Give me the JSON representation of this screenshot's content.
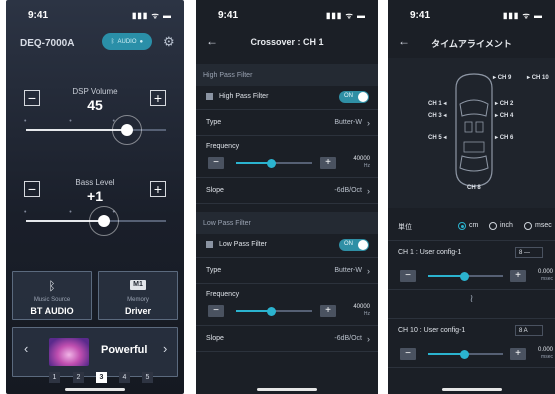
{
  "s1": {
    "time": "9:41",
    "signal": "▮▮▮ ᯤ ▬",
    "model": "DEQ-7000A",
    "source_pill": "AUDIO",
    "dsp": {
      "label": "DSP Volume",
      "value": "45",
      "level": 0.72
    },
    "bass": {
      "label": "Bass Level",
      "value": "+1",
      "level": 0.56
    },
    "minus": "−",
    "plus": "+",
    "music_source": {
      "caption": "Music Source",
      "value": "BT AUDIO"
    },
    "memory": {
      "badge": "M1",
      "caption": "Memory",
      "value": "Driver"
    },
    "preset": {
      "name": "Powerful",
      "numbers": [
        "1",
        "2",
        "3",
        "4",
        "5"
      ],
      "selected": "3"
    },
    "prev": "‹",
    "next": "›"
  },
  "s2": {
    "time": "9:41",
    "signal": "▮▮▮ ᯤ ▬",
    "back": "←",
    "title": "Crossover : CH 1",
    "hpf": {
      "section": "High Pass Filter",
      "toggle_label": "High Pass Filter",
      "toggle": "ON",
      "type_label": "Type",
      "type_value": "Butter-W",
      "freq_label": "Frequency",
      "freq_value": "40000",
      "freq_unit": "Hz",
      "freq_level": 0.47,
      "slope_label": "Slope",
      "slope_value": "-6dB/Oct"
    },
    "lpf": {
      "section": "Low Pass Filter",
      "toggle_label": "Low Pass Filter",
      "toggle": "ON",
      "type_label": "Type",
      "type_value": "Butter-W",
      "freq_label": "Frequency",
      "freq_value": "40000",
      "freq_unit": "Hz",
      "freq_level": 0.47,
      "slope_label": "Slope",
      "slope_value": "-6dB/Oct"
    },
    "minus": "−",
    "plus": "+",
    "chevron": "›"
  },
  "s3": {
    "time": "9:41",
    "signal": "▮▮▮ ᯤ ▬",
    "back": "←",
    "title": "タイムアライメント",
    "channels": {
      "ch1": "CH 1",
      "ch2": "CH 2",
      "ch3": "CH 3",
      "ch4": "CH 4",
      "ch5": "CH 5",
      "ch6": "CH 6",
      "ch8": "CH 8",
      "ch9": "CH 9",
      "ch10": "CH 10"
    },
    "units_label": "単位",
    "unit_options": [
      "cm",
      "inch",
      "msec"
    ],
    "unit_selected": "cm",
    "ch1_config": {
      "label": "CH 1 : User config-1",
      "select": "8  —",
      "value": "0.000",
      "unit": "msec",
      "level": 0.48
    },
    "ch10_config": {
      "label": "CH 10 : User config-1",
      "select": "8  A",
      "value": "0.000",
      "unit": "msec",
      "level": 0.48
    },
    "tilde": "≀",
    "minus": "−",
    "plus": "+"
  }
}
